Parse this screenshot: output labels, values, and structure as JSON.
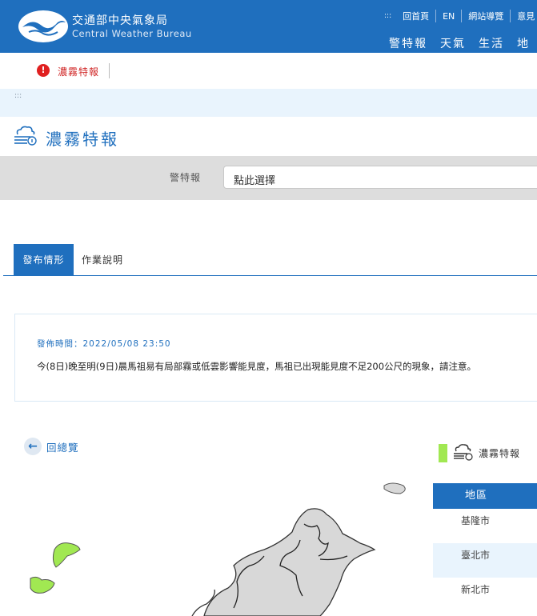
{
  "header": {
    "brand_zh": "交通部中央氣象局",
    "brand_en": "Central Weather Bureau",
    "top_links": [
      "回首頁",
      "EN",
      "網站導覽",
      "意見"
    ],
    "main_nav": [
      "警特報",
      "天氣",
      "生活",
      "地"
    ]
  },
  "alert": {
    "label": "濃霧特報"
  },
  "page": {
    "title": "濃霧特報",
    "select_label": "警特報",
    "select_value": "點此選擇"
  },
  "tabs": [
    {
      "label": "發布情形",
      "active": true
    },
    {
      "label": "作業說明",
      "active": false
    }
  ],
  "info": {
    "time": "發佈時間：2022/05/08 23:50",
    "body": "今(8日)晚至明(9日)晨馬祖易有局部霧或低雲影響能見度，馬祖已出現能見度不足200公尺的現象，請注意。"
  },
  "back_label": "回總覽",
  "legend": {
    "label": "濃霧特報",
    "color": "#a1e852"
  },
  "region_table": {
    "header": "地區",
    "rows": [
      "基隆市",
      "臺北市",
      "新北市"
    ]
  },
  "colors": {
    "brand": "#1f6fbe",
    "alert": "#e02020",
    "highlight": "#a1e852"
  }
}
